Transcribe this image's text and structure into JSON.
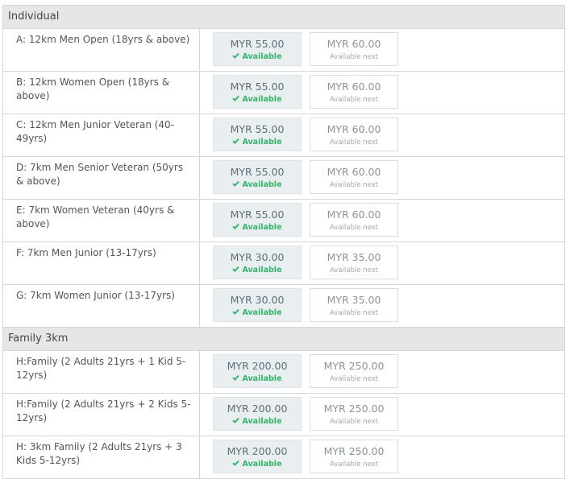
{
  "sections": [
    {
      "title": "Individual",
      "rows": [
        {
          "category": "A: 12km Men Open (18yrs & above)",
          "current_price": "MYR 55.00",
          "current_status": "Available",
          "next_price": "MYR 60.00",
          "next_status": "Available next"
        },
        {
          "category": "B: 12km Women Open (18yrs & above)",
          "current_price": "MYR 55.00",
          "current_status": "Available",
          "next_price": "MYR 60.00",
          "next_status": "Available next"
        },
        {
          "category": "C: 12km Men Junior Veteran (40-49yrs)",
          "current_price": "MYR 55.00",
          "current_status": "Available",
          "next_price": "MYR 60.00",
          "next_status": "Available next"
        },
        {
          "category": "D: 7km Men Senior Veteran (50yrs & above)",
          "current_price": "MYR 55.00",
          "current_status": "Available",
          "next_price": "MYR 60.00",
          "next_status": "Available next"
        },
        {
          "category": "E: 7km Women Veteran (40yrs & above)",
          "current_price": "MYR 55.00",
          "current_status": "Available",
          "next_price": "MYR 60.00",
          "next_status": "Available next"
        },
        {
          "category": "F: 7km Men Junior (13-17yrs)",
          "current_price": "MYR 30.00",
          "current_status": "Available",
          "next_price": "MYR 35.00",
          "next_status": "Available next"
        },
        {
          "category": "G: 7km Women Junior (13-17yrs)",
          "current_price": "MYR 30.00",
          "current_status": "Available",
          "next_price": "MYR 35.00",
          "next_status": "Available next"
        }
      ]
    },
    {
      "title": "Family 3km",
      "rows": [
        {
          "category": "H:Family (2 Adults 21yrs + 1 Kid 5-12yrs)",
          "current_price": "MYR 200.00",
          "current_status": "Available",
          "next_price": "MYR 250.00",
          "next_status": "Available next"
        },
        {
          "category": "H:Family (2 Adults 21yrs + 2 Kids 5-12yrs)",
          "current_price": "MYR 200.00",
          "current_status": "Available",
          "next_price": "MYR 250.00",
          "next_status": "Available next"
        },
        {
          "category": "H: 3km Family (2 Adults 21yrs + 3 Kids 5-12yrs)",
          "current_price": "MYR 200.00",
          "current_status": "Available",
          "next_price": "MYR 250.00",
          "next_status": "Available next"
        }
      ]
    }
  ],
  "icons": {
    "available": "check-icon"
  },
  "colors": {
    "available_green": "#35b36b",
    "header_bg": "#e6e6e6",
    "price_bg": "#e9eef0"
  }
}
